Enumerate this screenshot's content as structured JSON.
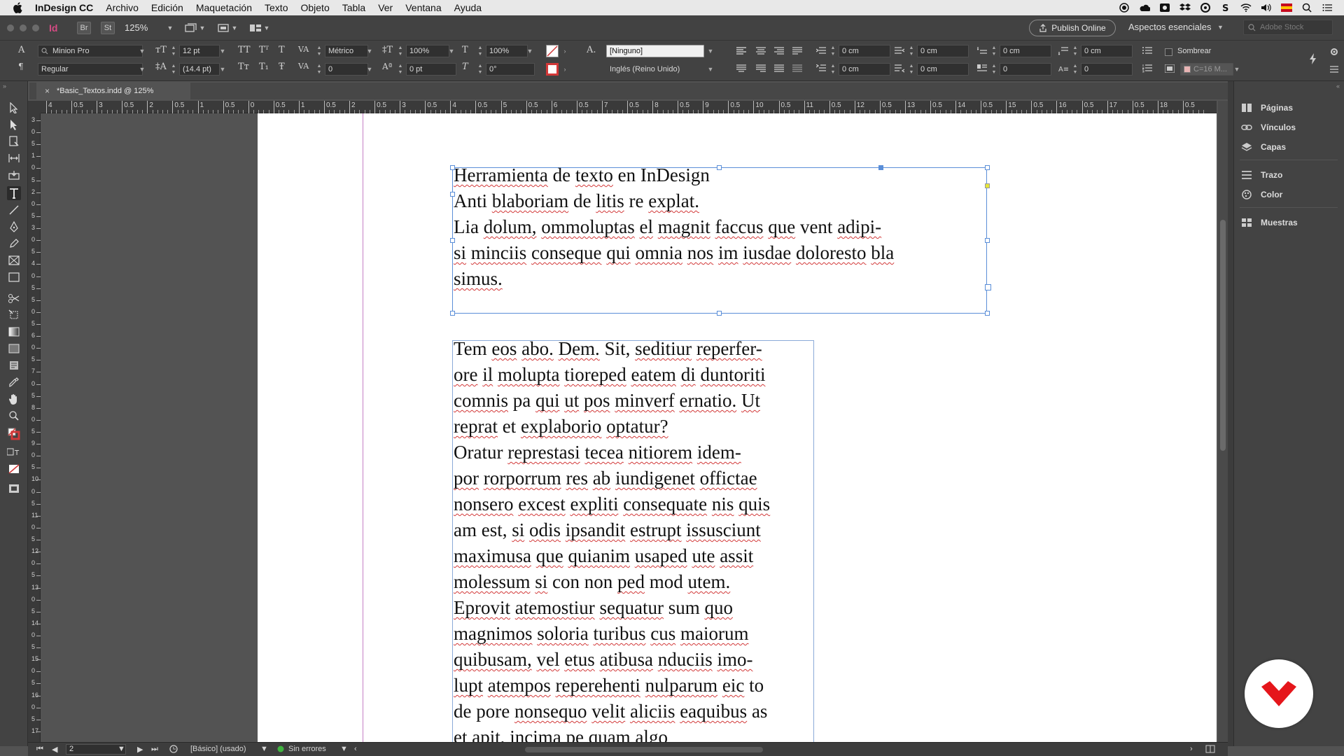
{
  "menubar": {
    "app_name": "InDesign CC",
    "items": [
      "Archivo",
      "Edición",
      "Maquetación",
      "Texto",
      "Objeto",
      "Tabla",
      "Ver",
      "Ventana",
      "Ayuda"
    ]
  },
  "appbar": {
    "logo": "Id",
    "bridge_label": "Br",
    "stock_label": "St",
    "zoom_value": "125%",
    "publish_label": "Publish Online",
    "workspace_label": "Aspectos esenciales",
    "search_placeholder": "Adobe Stock"
  },
  "control_panel": {
    "font_family": "Minion Pro",
    "font_style": "Regular",
    "font_size": "12 pt",
    "leading": "(14.4 pt)",
    "kerning": "Métrico",
    "tracking": "0",
    "vertical_scale": "100%",
    "horizontal_scale": "100%",
    "baseline_shift": "0 pt",
    "skew": "0°",
    "char_style": "[Ninguno]",
    "language": "Inglés (Reino Unido)",
    "indent_left": "0 cm",
    "indent_right": "0 cm",
    "first_line_indent": "0 cm",
    "last_line_indent": "0 cm",
    "space_before": "0 cm",
    "space_after": "0 cm",
    "drop_cap_lines": "0",
    "drop_cap_chars": "0",
    "shading_label": "Sombrear",
    "swatch_label": "C=16 M..."
  },
  "document": {
    "tab_label": "*Basic_Textos.indd @ 125%"
  },
  "ruler": {
    "h_ticks": [
      "4",
      "0.5",
      "3",
      "0.5",
      "2",
      "0.5",
      "1",
      "0.5",
      "0",
      "0.5",
      "1",
      "0.5",
      "2",
      "0.5",
      "3",
      "0.5",
      "4",
      "0.5",
      "5",
      "0.5",
      "6",
      "0.5",
      "7",
      "0.5",
      "8",
      "0.5",
      "9",
      "0.5",
      "10",
      "0.5",
      "11",
      "0.5",
      "12",
      "0.5",
      "13",
      "0.5",
      "14",
      "0.5",
      "15",
      "0.5",
      "16",
      "0.5",
      "17",
      "0.5",
      "18",
      "0.5"
    ],
    "v_ticks": [
      "3",
      "0",
      "5",
      "1",
      "0",
      "5",
      "2",
      "0",
      "5",
      "3",
      "0",
      "5",
      "4",
      "0",
      "5",
      "5",
      "0",
      "5",
      "6",
      "0",
      "5",
      "7",
      "0",
      "5",
      "8",
      "0",
      "5",
      "9",
      "0",
      "5",
      "10",
      "0",
      "5",
      "11",
      "0",
      "5",
      "12",
      "0",
      "5",
      "13",
      "0",
      "5",
      "14",
      "0",
      "5",
      "15",
      "0",
      "5",
      "16",
      "0",
      "5",
      "17"
    ]
  },
  "frame1": {
    "lines": [
      [
        [
          "Herramienta",
          true
        ],
        [
          " de ",
          false
        ],
        [
          "texto",
          true
        ],
        [
          " en InDesign",
          false
        ]
      ],
      [
        [
          "Anti ",
          false
        ],
        [
          "blaboriam",
          true
        ],
        [
          " de ",
          false
        ],
        [
          "litis",
          true
        ],
        [
          " re ",
          false
        ],
        [
          "explat.",
          true
        ]
      ],
      [
        [
          "Lia ",
          false
        ],
        [
          "dolum,",
          true
        ],
        [
          " ",
          false
        ],
        [
          "ommoluptas",
          true
        ],
        [
          " ",
          false
        ],
        [
          "el",
          true
        ],
        [
          " ",
          false
        ],
        [
          "magnit",
          true
        ],
        [
          " ",
          false
        ],
        [
          "faccus",
          true
        ],
        [
          " ",
          false
        ],
        [
          "que",
          true
        ],
        [
          " vent ",
          false
        ],
        [
          "adipi-",
          true
        ]
      ],
      [
        [
          "si",
          true
        ],
        [
          " ",
          false
        ],
        [
          "minciis",
          true
        ],
        [
          " ",
          false
        ],
        [
          "conseque",
          true
        ],
        [
          " ",
          false
        ],
        [
          "qui",
          true
        ],
        [
          " ",
          false
        ],
        [
          "omnia",
          true
        ],
        [
          " ",
          false
        ],
        [
          "nos",
          true
        ],
        [
          " ",
          false
        ],
        [
          "im",
          true
        ],
        [
          " ",
          false
        ],
        [
          "iusdae",
          true
        ],
        [
          " ",
          false
        ],
        [
          "doloresto",
          true
        ],
        [
          " ",
          false
        ],
        [
          "bla",
          true
        ]
      ],
      [
        [
          "simus.",
          true
        ]
      ]
    ]
  },
  "frame2": {
    "lines": [
      [
        [
          "Tem",
          false
        ],
        [
          " ",
          false
        ],
        [
          "eos",
          true
        ],
        [
          " ",
          false
        ],
        [
          "abo.",
          true
        ],
        [
          " ",
          false
        ],
        [
          "Dem.",
          true
        ],
        [
          " Sit, ",
          false
        ],
        [
          "seditiur",
          true
        ],
        [
          " ",
          false
        ],
        [
          "reperfer-",
          true
        ]
      ],
      [
        [
          "ore",
          true
        ],
        [
          " ",
          false
        ],
        [
          "il",
          true
        ],
        [
          " ",
          false
        ],
        [
          "molupta",
          true
        ],
        [
          " ",
          false
        ],
        [
          "tioreped",
          true
        ],
        [
          " ",
          false
        ],
        [
          "eatem",
          true
        ],
        [
          " ",
          false
        ],
        [
          "di",
          true
        ],
        [
          " ",
          false
        ],
        [
          "duntoriti",
          true
        ]
      ],
      [
        [
          "comnis",
          true
        ],
        [
          " pa ",
          false
        ],
        [
          "qui",
          true
        ],
        [
          " ",
          false
        ],
        [
          "ut",
          true
        ],
        [
          " ",
          false
        ],
        [
          "pos",
          true
        ],
        [
          " ",
          false
        ],
        [
          "minverf",
          true
        ],
        [
          " ",
          false
        ],
        [
          "ernatio.",
          true
        ],
        [
          " ",
          false
        ],
        [
          "Ut",
          true
        ]
      ],
      [
        [
          "reprat",
          true
        ],
        [
          " et ",
          false
        ],
        [
          "explaborio",
          true
        ],
        [
          " ",
          false
        ],
        [
          "optatur?",
          true
        ]
      ],
      [
        [
          "Oratur",
          false
        ],
        [
          " ",
          false
        ],
        [
          "represtasi",
          true
        ],
        [
          " ",
          false
        ],
        [
          "tecea",
          true
        ],
        [
          " ",
          false
        ],
        [
          "nitiorem",
          true
        ],
        [
          " ",
          false
        ],
        [
          "idem-",
          true
        ]
      ],
      [
        [
          "por",
          true
        ],
        [
          " ",
          false
        ],
        [
          "rorporrum",
          true
        ],
        [
          " ",
          false
        ],
        [
          "res",
          true
        ],
        [
          " ",
          false
        ],
        [
          "ab",
          true
        ],
        [
          " ",
          false
        ],
        [
          "iundigenet",
          true
        ],
        [
          " ",
          false
        ],
        [
          "offictae",
          true
        ]
      ],
      [
        [
          "nonsero",
          true
        ],
        [
          " ",
          false
        ],
        [
          "excest",
          true
        ],
        [
          " ",
          false
        ],
        [
          "expliti",
          true
        ],
        [
          " ",
          false
        ],
        [
          "consequate",
          true
        ],
        [
          " ",
          false
        ],
        [
          "nis",
          true
        ],
        [
          " ",
          false
        ],
        [
          "quis",
          true
        ]
      ],
      [
        [
          "am est, ",
          false
        ],
        [
          "si",
          true
        ],
        [
          " ",
          false
        ],
        [
          "odis",
          true
        ],
        [
          " ",
          false
        ],
        [
          "ipsandit",
          true
        ],
        [
          " ",
          false
        ],
        [
          "estrupt",
          true
        ],
        [
          " ",
          false
        ],
        [
          "issusciunt",
          true
        ]
      ],
      [
        [
          "maximusa",
          true
        ],
        [
          " ",
          false
        ],
        [
          "que",
          true
        ],
        [
          " ",
          false
        ],
        [
          "quianim",
          true
        ],
        [
          " ",
          false
        ],
        [
          "usaped",
          true
        ],
        [
          " ",
          false
        ],
        [
          "ute",
          true
        ],
        [
          " ",
          false
        ],
        [
          "assit",
          true
        ]
      ],
      [
        [
          "molessum",
          true
        ],
        [
          " ",
          false
        ],
        [
          "si",
          true
        ],
        [
          " con non ",
          false
        ],
        [
          "ped",
          true
        ],
        [
          " mod ",
          false
        ],
        [
          "utem.",
          true
        ]
      ],
      [
        [
          "Eprovit",
          true
        ],
        [
          " ",
          false
        ],
        [
          "atemostiur",
          true
        ],
        [
          " ",
          false
        ],
        [
          "sequatur",
          true
        ],
        [
          " sum ",
          false
        ],
        [
          "quo",
          true
        ]
      ],
      [
        [
          "magnimos",
          true
        ],
        [
          " ",
          false
        ],
        [
          "soloria",
          true
        ],
        [
          " ",
          false
        ],
        [
          "turibus",
          true
        ],
        [
          " ",
          false
        ],
        [
          "cus",
          true
        ],
        [
          " ",
          false
        ],
        [
          "maiorum",
          true
        ]
      ],
      [
        [
          "quibusam,",
          true
        ],
        [
          " ",
          false
        ],
        [
          "vel",
          true
        ],
        [
          " ",
          false
        ],
        [
          "etus",
          true
        ],
        [
          " ",
          false
        ],
        [
          "atibusa",
          true
        ],
        [
          " ",
          false
        ],
        [
          "nduciis",
          true
        ],
        [
          " ",
          false
        ],
        [
          "imo-",
          true
        ]
      ],
      [
        [
          "lupt",
          true
        ],
        [
          " ",
          false
        ],
        [
          "atempos",
          true
        ],
        [
          " ",
          false
        ],
        [
          "reperehenti",
          true
        ],
        [
          " ",
          false
        ],
        [
          "nulparum",
          true
        ],
        [
          " ",
          false
        ],
        [
          "eic",
          true
        ],
        [
          " to",
          false
        ]
      ],
      [
        [
          "de pore ",
          false
        ],
        [
          "nonsequo",
          true
        ],
        [
          " ",
          false
        ],
        [
          "velit",
          true
        ],
        [
          " ",
          false
        ],
        [
          "aliciis",
          true
        ],
        [
          " ",
          false
        ],
        [
          "eaquibus",
          true
        ],
        [
          " as",
          false
        ]
      ],
      [
        [
          "et apit, ",
          false
        ],
        [
          "incima",
          true
        ],
        [
          " pe ",
          false
        ],
        [
          "quam",
          true
        ],
        [
          " ",
          false
        ],
        [
          "algo",
          true
        ]
      ]
    ]
  },
  "panel": {
    "items": [
      "Páginas",
      "Vínculos",
      "Capas",
      "Trazo",
      "Color",
      "Muestras"
    ]
  },
  "status": {
    "page_number": "2",
    "master_label": "[Básico] (usado)",
    "preflight_label": "Sin errores"
  },
  "colors": {
    "frame_border": "#5a8ed8",
    "margin_guide": "#c57ec5",
    "spellcheck": "#d23838",
    "badge": "#e5161b",
    "preflight_ok": "#3fb43f"
  }
}
